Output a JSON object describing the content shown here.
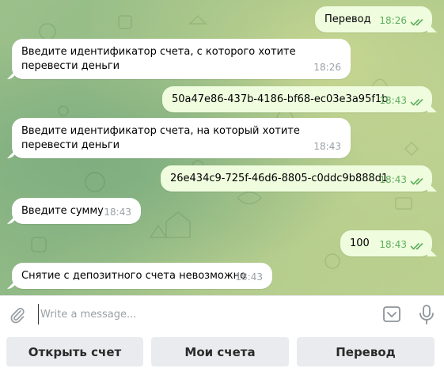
{
  "messages": [
    {
      "dir": "out",
      "text": "Перевод",
      "time": "18:26",
      "read": true
    },
    {
      "dir": "in",
      "text": "Введите идентификатор счета, с которого хотите перевести деньги",
      "time": "18:26"
    },
    {
      "dir": "out",
      "text": "50a47e86-437b-4186-bf68-ec03e3a95f1b",
      "time": "18:43",
      "read": true
    },
    {
      "dir": "in",
      "text": "Введите идентификатор счета, на который хотите перевести деньги",
      "time": "18:43"
    },
    {
      "dir": "out",
      "text": "26e434c9-725f-46d6-8805-c0ddc9b888d1",
      "time": "18:43",
      "read": true
    },
    {
      "dir": "in",
      "text": "Введите сумму",
      "time": "18:43"
    },
    {
      "dir": "out",
      "text": "100",
      "time": "18:43",
      "read": true
    },
    {
      "dir": "in",
      "text": "Снятие с депозитного счета невозможно",
      "time": "18:43"
    }
  ],
  "composer": {
    "placeholder": "Write a message...",
    "attach_icon": "paperclip-icon",
    "keyboard_icon": "bot-keyboard-icon",
    "mic_icon": "microphone-icon"
  },
  "keyboard": {
    "buttons": [
      "Открыть счет",
      "Мои счета",
      "Перевод"
    ]
  },
  "colors": {
    "outgoing_bubble": "#effdde",
    "incoming_bubble": "#ffffff",
    "time_out": "#5fae5e",
    "time_in": "#9aa1a6",
    "keyboard_button": "#e9ebee"
  }
}
